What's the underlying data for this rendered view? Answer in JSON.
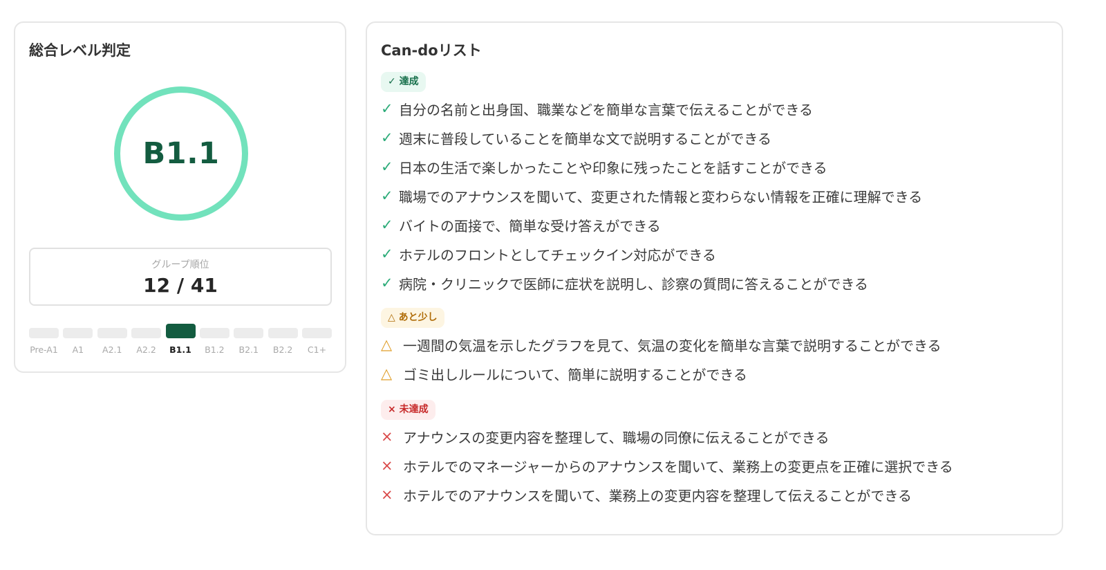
{
  "level_panel": {
    "title": "総合レベル判定",
    "current_level": "B1.1",
    "rank": {
      "label": "グループ順位",
      "value": "12 / 41"
    },
    "levels": [
      "Pre-A1",
      "A1",
      "A2.1",
      "A2.2",
      "B1.1",
      "B1.2",
      "B2.1",
      "B2.2",
      "C1+"
    ],
    "active_level_index": 4
  },
  "cando": {
    "title": "Can-doリスト",
    "achieved": {
      "label": "✓ 達成",
      "mark": "✓",
      "items": [
        "自分の名前と出身国、職業などを簡単な言葉で伝えることができる",
        "週末に普段していることを簡単な文で説明することができる",
        "日本の生活で楽しかったことや印象に残ったことを話すことができる",
        "職場でのアナウンスを聞いて、変更された情報と変わらない情報を正確に理解できる",
        "バイトの面接で、簡単な受け答えができる",
        "ホテルのフロントとしてチェックイン対応ができる",
        "病院・クリニックで医師に症状を説明し、診察の質問に答えることができる"
      ]
    },
    "almost": {
      "label": "△ あと少し",
      "mark": "△",
      "items": [
        "一週間の気温を示したグラフを見て、気温の変化を簡単な言葉で説明することができる",
        "ゴミ出しルールについて、簡単に説明することができる"
      ]
    },
    "not_achieved": {
      "label": "× 未達成",
      "mark": "×",
      "items": [
        "アナウンスの変更内容を整理して、職場の同僚に伝えることができる",
        "ホテルでのマネージャーからのアナウンスを聞いて、業務上の変更点を正確に選択できる",
        "ホテルでのアナウンスを聞いて、業務上の変更内容を整理して伝えることができる"
      ]
    }
  }
}
